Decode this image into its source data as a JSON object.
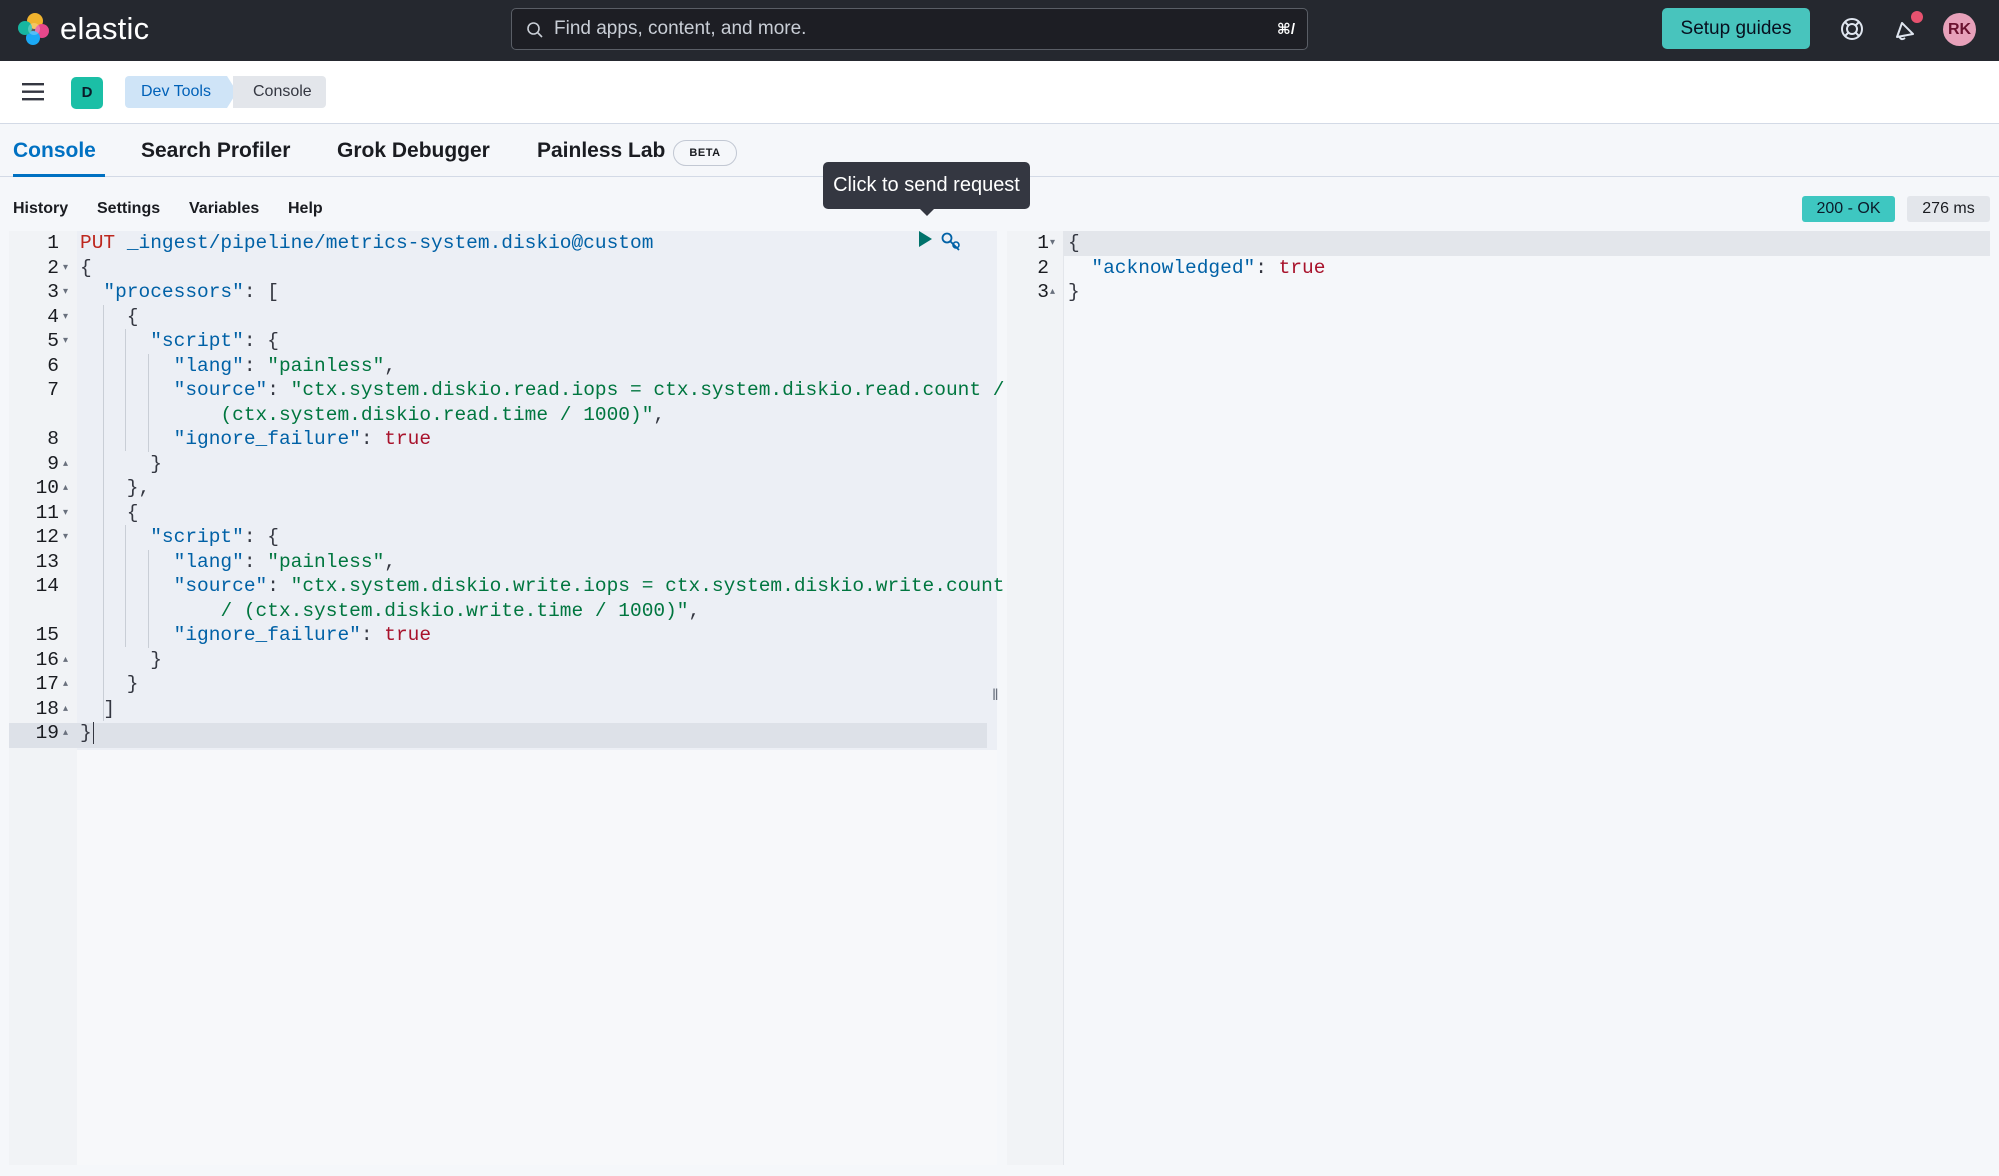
{
  "topbar": {
    "brand": "elastic",
    "search_placeholder": "Find apps, content, and more.",
    "search_shortcut": "⌘/",
    "setup_guides_label": "Setup guides",
    "avatar_initials": "RK"
  },
  "subbar": {
    "space_initial": "D",
    "breadcrumbs": [
      "Dev Tools",
      "Console"
    ]
  },
  "tabs": [
    {
      "label": "Console",
      "active": true
    },
    {
      "label": "Search Profiler"
    },
    {
      "label": "Grok Debugger"
    },
    {
      "label": "Painless Lab"
    }
  ],
  "beta_label": "BETA",
  "toolbar": {
    "items": [
      "History",
      "Settings",
      "Variables",
      "Help"
    ],
    "status": "200 - OK",
    "time": "276 ms"
  },
  "tooltip": "Click to send request",
  "request": {
    "method": "PUT",
    "path": "_ingest/pipeline/metrics-system.diskio@custom",
    "line_numbers": [
      "1",
      "2",
      "3",
      "4",
      "5",
      "6",
      "7",
      "8",
      "9",
      "10",
      "11",
      "12",
      "13",
      "14",
      "15",
      "16",
      "17",
      "18",
      "19"
    ],
    "key_processors": "\"processors\"",
    "key_script": "\"script\"",
    "key_lang": "\"lang\"",
    "val_painless": "\"painless\"",
    "key_source": "\"source\"",
    "source_read_1": "\"ctx.system.diskio.read.iops = ctx.system.diskio.read.count /",
    "source_read_2": "(ctx.system.diskio.read.time / 1000)\"",
    "source_write_1": "\"ctx.system.diskio.write.iops = ctx.system.diskio.write.count",
    "source_write_2": "/ (ctx.system.diskio.write.time / 1000)\"",
    "key_ignore": "\"ignore_failure\"",
    "val_true": "true"
  },
  "response": {
    "line_numbers": [
      "1",
      "2",
      "3"
    ],
    "key": "\"acknowledged\"",
    "value": "true"
  },
  "colors": {
    "topbar_bg": "#25282f",
    "accent": "#0071c2",
    "setup_button": "#48c4bd",
    "status_ok": "#3ec7c1"
  }
}
